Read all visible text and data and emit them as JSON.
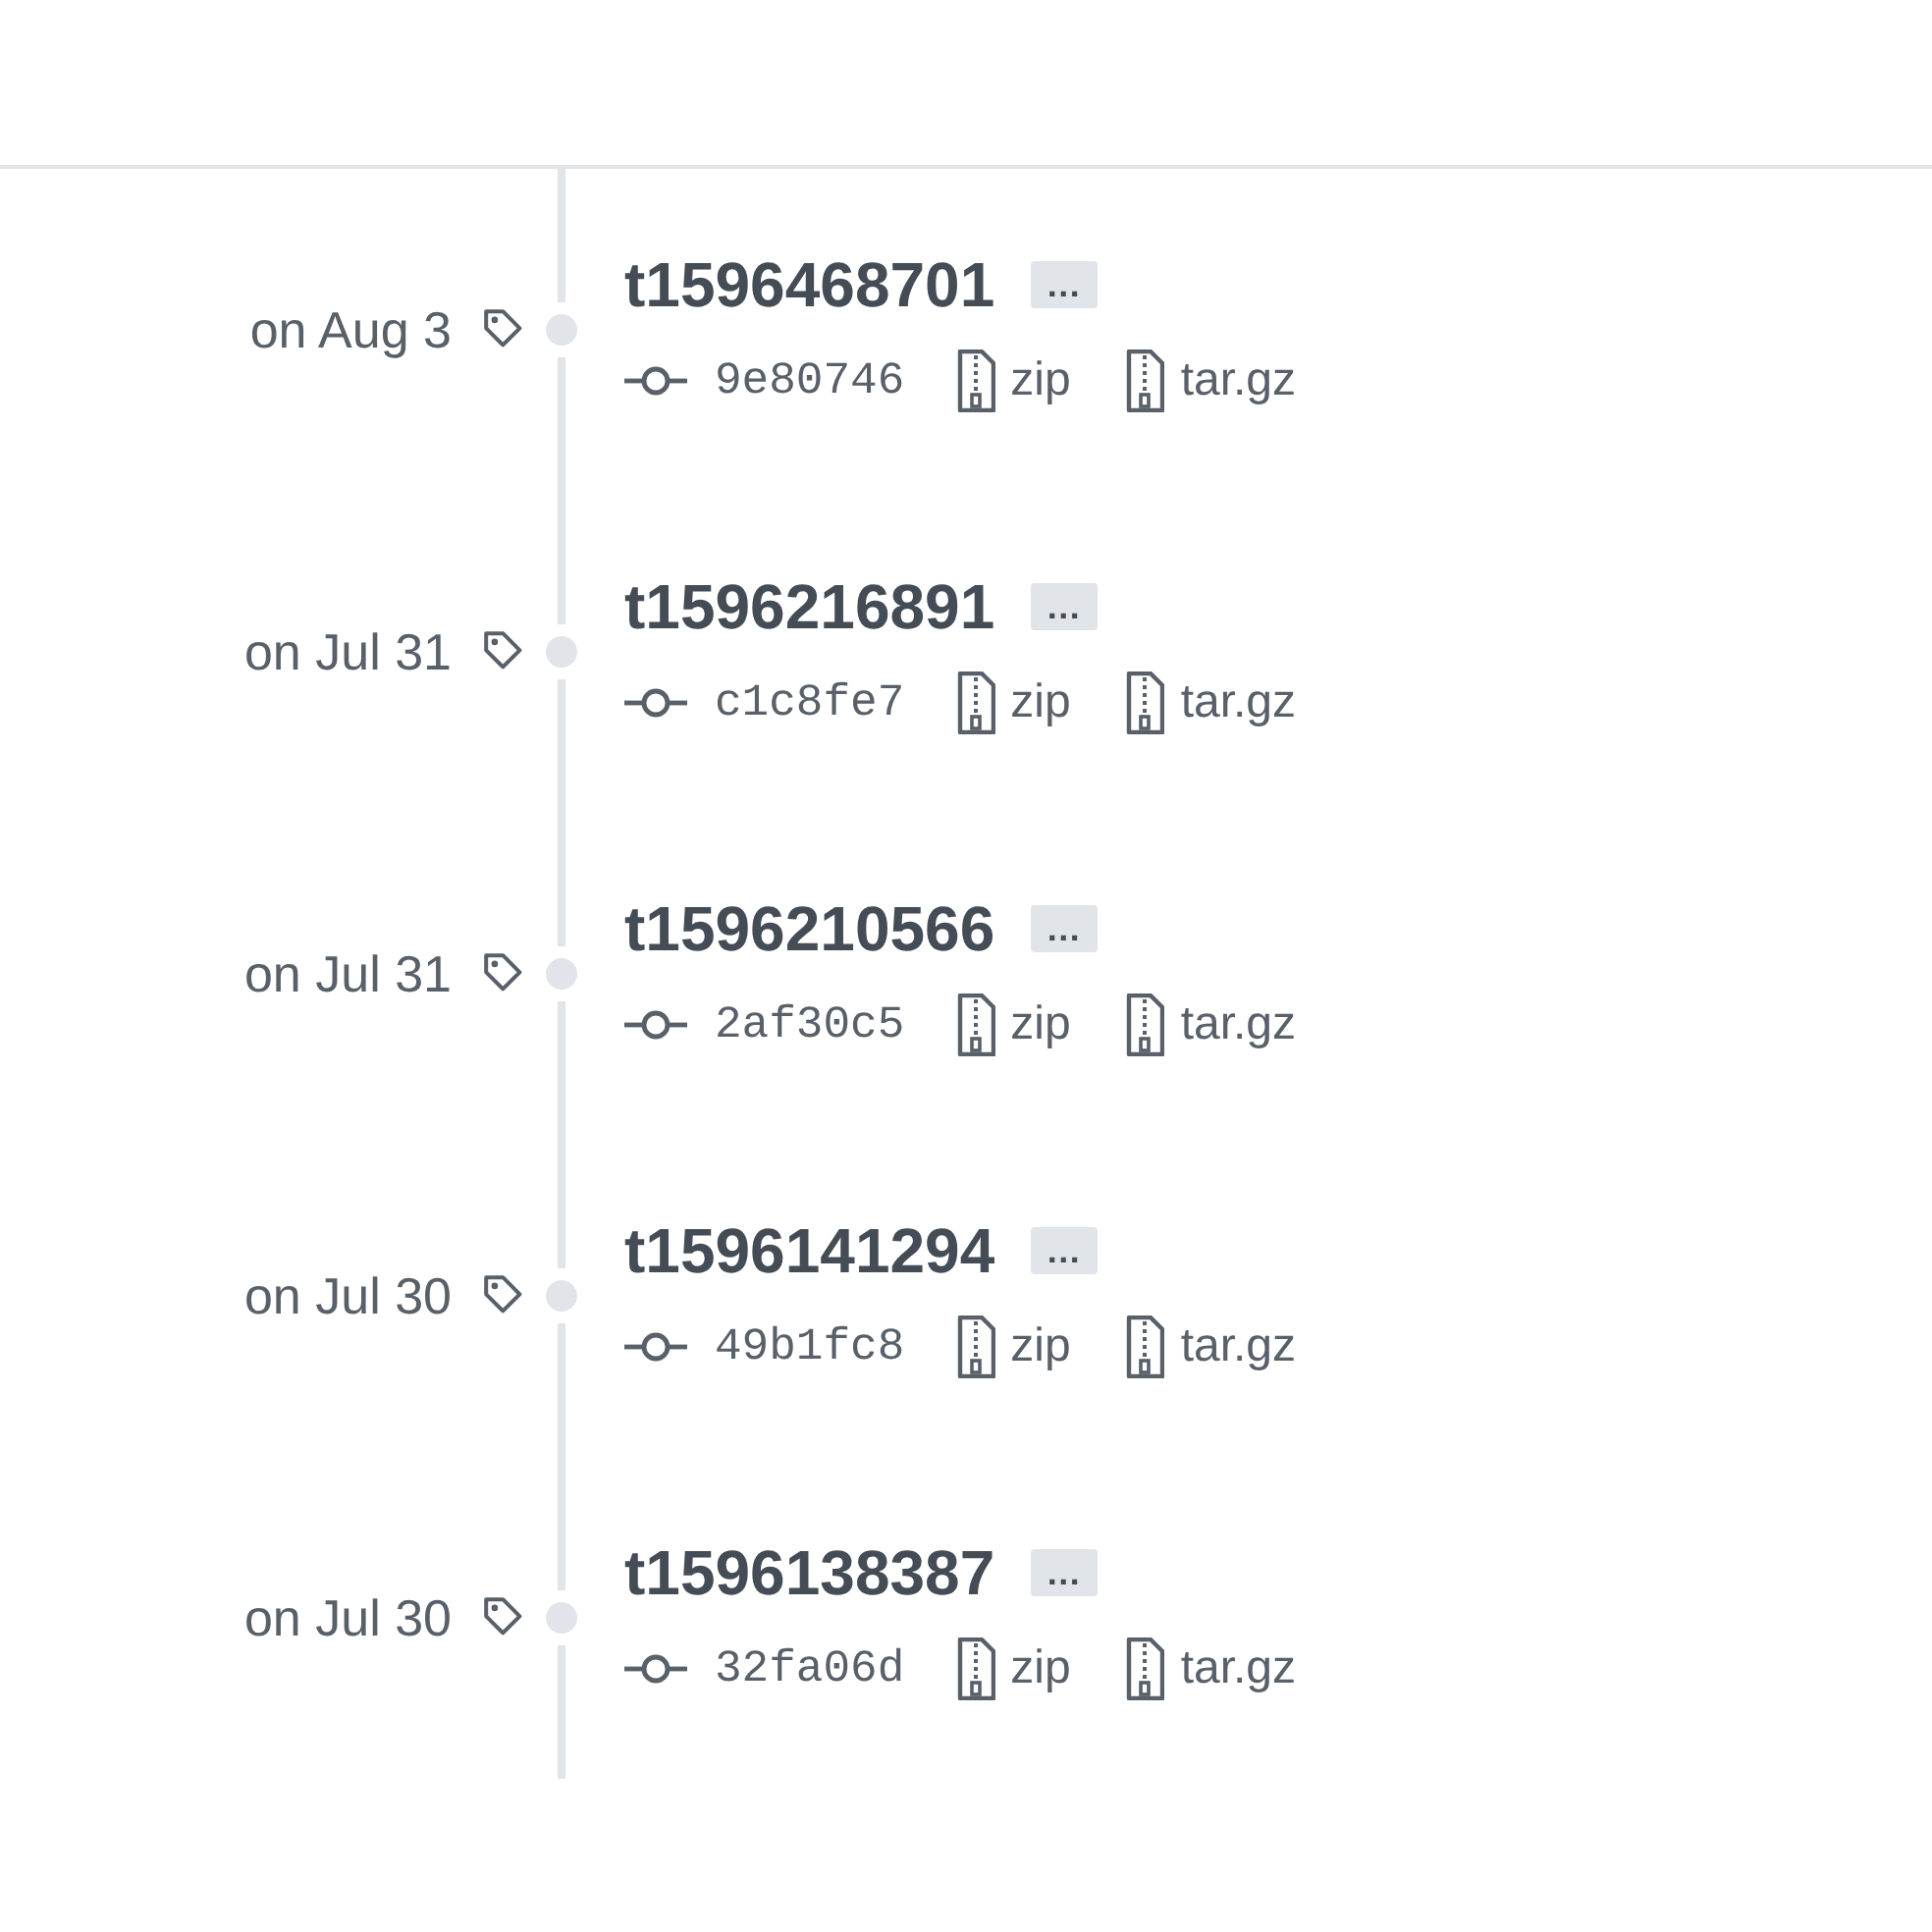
{
  "tags": [
    {
      "date": "on Aug 3",
      "name": "t1596468701",
      "more": "…",
      "commit": "9e80746",
      "downloads": [
        "zip",
        "tar.gz"
      ]
    },
    {
      "date": "on Jul 31",
      "name": "t1596216891",
      "more": "…",
      "commit": "c1c8fe7",
      "downloads": [
        "zip",
        "tar.gz"
      ]
    },
    {
      "date": "on Jul 31",
      "name": "t1596210566",
      "more": "…",
      "commit": "2af30c5",
      "downloads": [
        "zip",
        "tar.gz"
      ]
    },
    {
      "date": "on Jul 30",
      "name": "t1596141294",
      "more": "…",
      "commit": "49b1fc8",
      "downloads": [
        "zip",
        "tar.gz"
      ]
    },
    {
      "date": "on Jul 30",
      "name": "t1596138387",
      "more": "…",
      "commit": "32fa06d",
      "downloads": [
        "zip",
        "tar.gz"
      ]
    }
  ]
}
